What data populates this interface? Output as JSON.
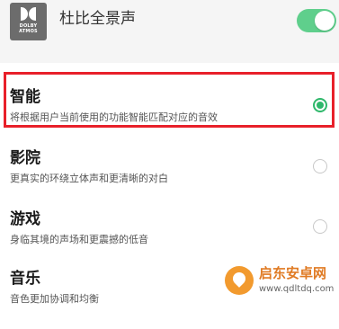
{
  "header": {
    "title": "杜比全景声",
    "logo_icon": "dolby-atmos-logo",
    "logo_text": [
      "DOLBY",
      "ATMOS"
    ],
    "toggle_on": true,
    "toggle_color": "#5fcf8c"
  },
  "options": [
    {
      "title": "智能",
      "desc": "将根据用户当前使用的功能智能匹配对应的音效",
      "selected": true
    },
    {
      "title": "影院",
      "desc": "更真实的环绕立体声和更清晰的对白",
      "selected": false
    },
    {
      "title": "游戏",
      "desc": "身临其境的声场和更震撼的低音",
      "selected": false
    },
    {
      "title": "音乐",
      "desc": "音色更加协调和均衡",
      "selected": false
    }
  ],
  "accent_color": "#2fb86b",
  "highlight_color": "#e8202a",
  "watermark": {
    "title": "启东安卓网",
    "url": "www.qdltdq.com"
  }
}
